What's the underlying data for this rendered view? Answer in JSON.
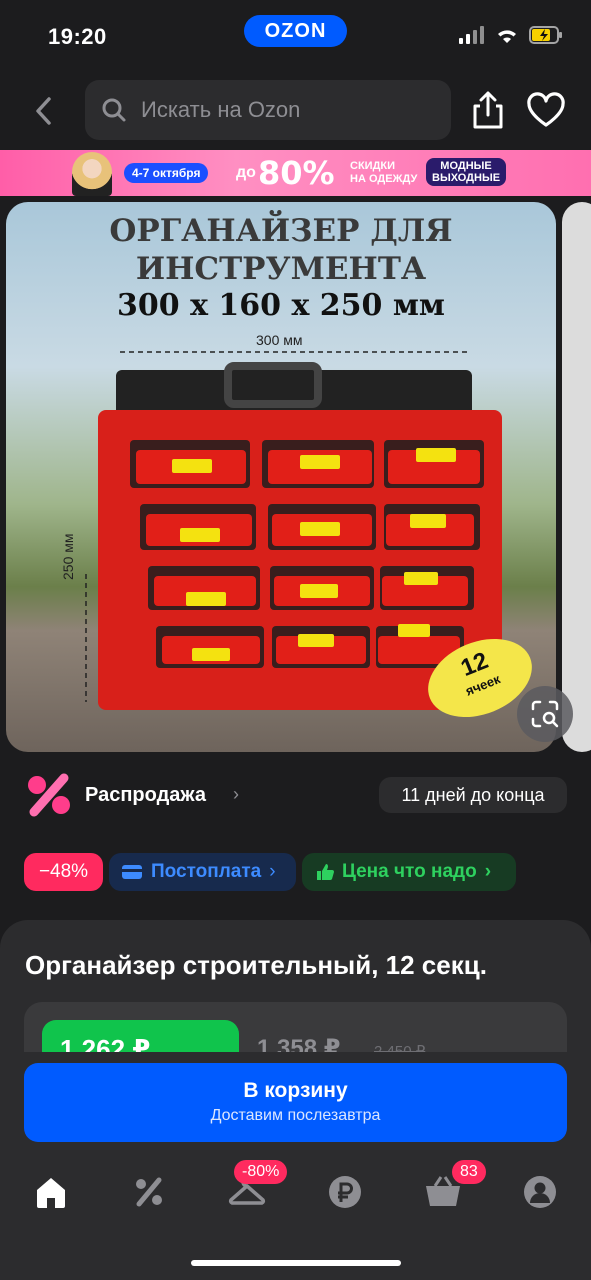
{
  "status_bar": {
    "time": "19:20",
    "brand": "OZON"
  },
  "search": {
    "placeholder": "Искать на Ozon"
  },
  "promo": {
    "dates": "4-7 октября",
    "prefix": "до",
    "percent": "80%",
    "subtitle_line1": "СКИДКИ",
    "subtitle_line2": "НА ОДЕЖДУ",
    "tag_line1": "МОДНЫЕ",
    "tag_line2": "ВЫХОДНЫЕ"
  },
  "gallery": {
    "title_line1": "ОРГАНАЙЗЕР ДЛЯ",
    "title_line2": "ИНСТРУМЕНТА",
    "size": "300 х 160 х 250 мм",
    "width_label": "300 мм",
    "height_label": "250 мм",
    "badge_number": "12",
    "badge_text": "ячеек"
  },
  "sale": {
    "label": "Распродажа",
    "countdown": "11 дней до конца"
  },
  "badges": {
    "discount": "−48%",
    "postpay": "Постоплата",
    "price_tag": "Цена что надо"
  },
  "product": {
    "title": "Органайзер строительный, 12 секц.",
    "price_card": "1 262 ₽",
    "price_regular": "1 358 ₽",
    "price_old": "2 450 ₽"
  },
  "cart": {
    "label": "В корзину",
    "sublabel": "Доставим послезавтра"
  },
  "tabbar": {
    "clothes_badge": "-80%",
    "cart_badge": "83"
  },
  "colors": {
    "accent": "#005bff",
    "discount": "#ff2a5f",
    "green": "#10c44c",
    "background": "#1c1c1e"
  }
}
